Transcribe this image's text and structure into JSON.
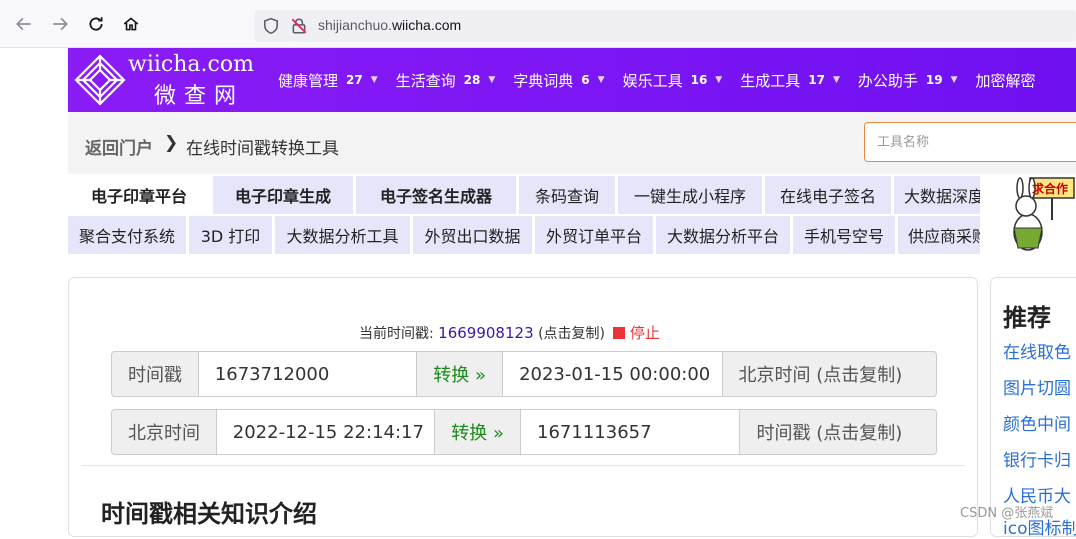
{
  "browser": {
    "url_prefix": "shijianchuo.",
    "url_domain": "wiicha.com"
  },
  "site": {
    "logo_en": "wiicha.com",
    "logo_cn": "微查网",
    "nav": [
      {
        "label": "健康管理",
        "count": "27"
      },
      {
        "label": "生活查询",
        "count": "28"
      },
      {
        "label": "字典词典",
        "count": "6"
      },
      {
        "label": "娱乐工具",
        "count": "16"
      },
      {
        "label": "生成工具",
        "count": "17"
      },
      {
        "label": "办公助手",
        "count": "19"
      },
      {
        "label": "加密解密",
        "count": ""
      }
    ]
  },
  "breadcrumb": {
    "home": "返回门户",
    "page": "在线时间戳转换工具",
    "search_placeholder": "工具名称"
  },
  "links_row1": [
    "电子印章平台",
    "电子印章生成",
    "电子签名生成器",
    "条码查询",
    "一键生成小程序",
    "在线电子签名",
    "大数据深度"
  ],
  "links_row2": [
    "聚合支付系统",
    "3D 打印",
    "大数据分析工具",
    "外贸出口数据",
    "外贸订单平台",
    "大数据分析平台",
    "手机号空号",
    "供应商采购"
  ],
  "ad": {
    "text": "求合作"
  },
  "converter": {
    "current_label": "当前时间戳:",
    "current_value": "1669908123",
    "copy_hint": "(点击复制)",
    "stop_label": "停止",
    "row1": {
      "label": "时间戳",
      "input": "1673712000",
      "button": "转换 »",
      "output": "2023-01-15 00:00:00",
      "suffix": "北京时间 (点击复制)"
    },
    "row2": {
      "label": "北京时间",
      "input": "2022-12-15 22:14:17",
      "button": "转换 »",
      "output": "1671113657",
      "suffix": "时间戳 (点击复制)"
    },
    "section_title": "时间戳相关知识介绍"
  },
  "sidebar": {
    "title": "推荐",
    "links": [
      "在线取色",
      "图片切圆",
      "颜色中间",
      "银行卡归",
      "人民币大",
      "ico图标制"
    ]
  },
  "watermark": "CSDN @张燕斌"
}
